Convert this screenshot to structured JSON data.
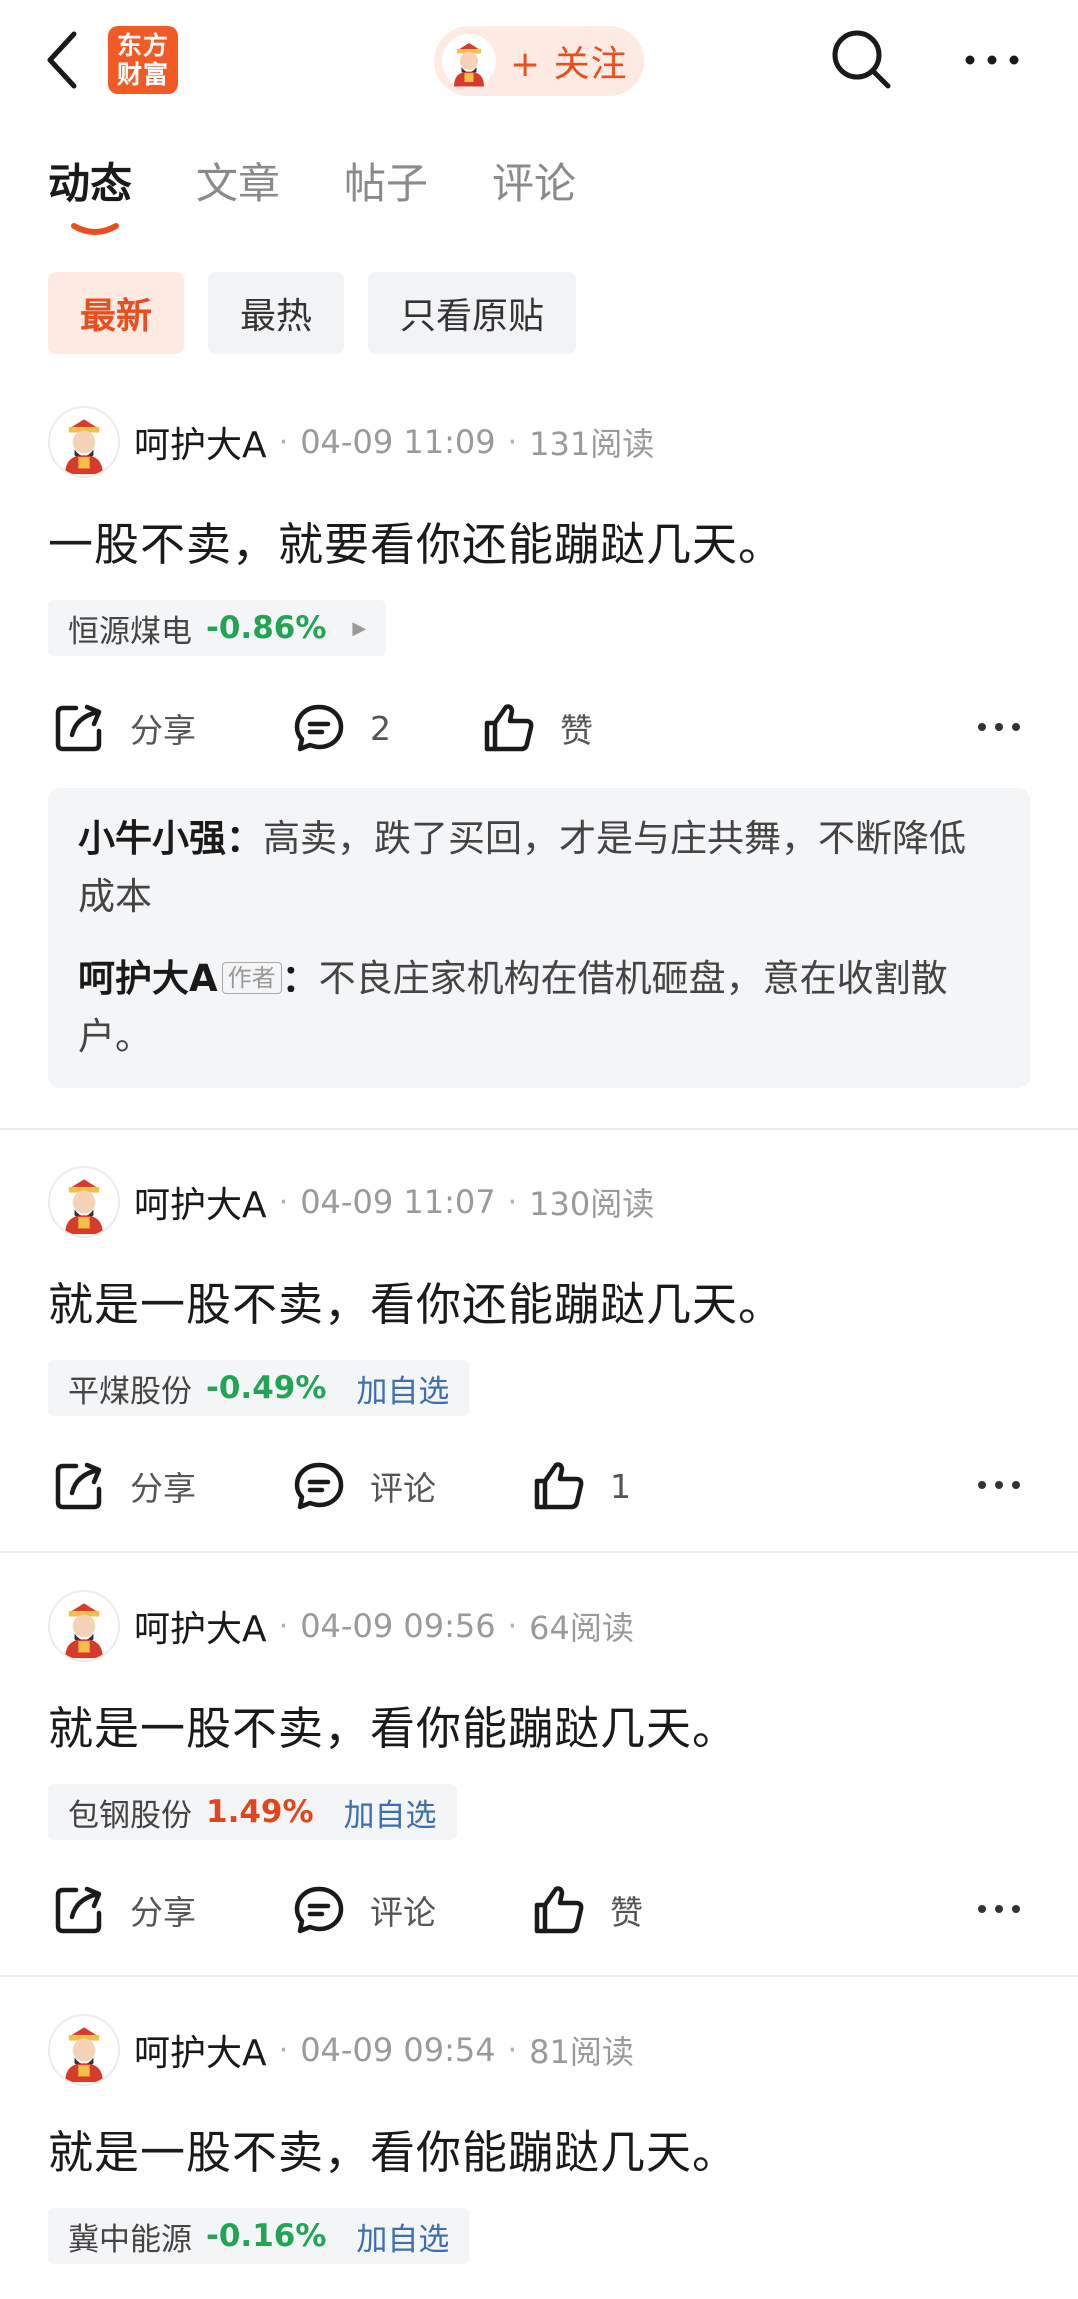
{
  "header": {
    "logo_line1": "东方",
    "logo_line2": "财富",
    "follow_label": "+ 关注"
  },
  "tabs": [
    {
      "label": "动态",
      "active": true
    },
    {
      "label": "文章",
      "active": false
    },
    {
      "label": "帖子",
      "active": false
    },
    {
      "label": "评论",
      "active": false
    }
  ],
  "filters": [
    {
      "label": "最新",
      "active": true
    },
    {
      "label": "最热",
      "active": false
    },
    {
      "label": "只看原贴",
      "active": false
    }
  ],
  "actions": {
    "share": "分享"
  },
  "posts": [
    {
      "author": "呵护大A",
      "date": "04-09 11:09",
      "reads": "131阅读",
      "text": "一股不卖，就要看你还能蹦跶几天。",
      "stock": {
        "name": "恒源煤电",
        "change": "-0.86%",
        "direction": "down"
      },
      "comment_count": "2",
      "like_label": "赞",
      "replies": [
        {
          "user": "小牛小强",
          "sep": "：",
          "text": "高卖，跌了买回，才是与庄共舞，不断降低成本"
        },
        {
          "user": "呵护大A",
          "tag": "作者",
          "sep": "：",
          "text": "不良庄家机构在借机砸盘，意在收割散户。"
        }
      ]
    },
    {
      "author": "呵护大A",
      "date": "04-09 11:07",
      "reads": "130阅读",
      "text": "就是一股不卖，看你还能蹦跶几天。",
      "stock": {
        "name": "平煤股份",
        "change": "-0.49%",
        "direction": "down",
        "add": "加自选"
      },
      "comment_label": "评论",
      "like_count": "1"
    },
    {
      "author": "呵护大A",
      "date": "04-09 09:56",
      "reads": "64阅读",
      "text": "就是一股不卖，看你能蹦跶几天。",
      "stock": {
        "name": "包钢股份",
        "change": "1.49%",
        "direction": "up",
        "add": "加自选"
      },
      "comment_label": "评论",
      "like_label": "赞"
    },
    {
      "author": "呵护大A",
      "date": "04-09 09:54",
      "reads": "81阅读",
      "text": "就是一股不卖，看你能蹦跶几天。",
      "stock": {
        "name": "冀中能源",
        "change": "-0.16%",
        "direction": "down",
        "add": "加自选"
      }
    }
  ],
  "colors": {
    "accent": "#e94f1e",
    "down": "#23a455",
    "up": "#e0461e",
    "link": "#3d6fb0"
  }
}
